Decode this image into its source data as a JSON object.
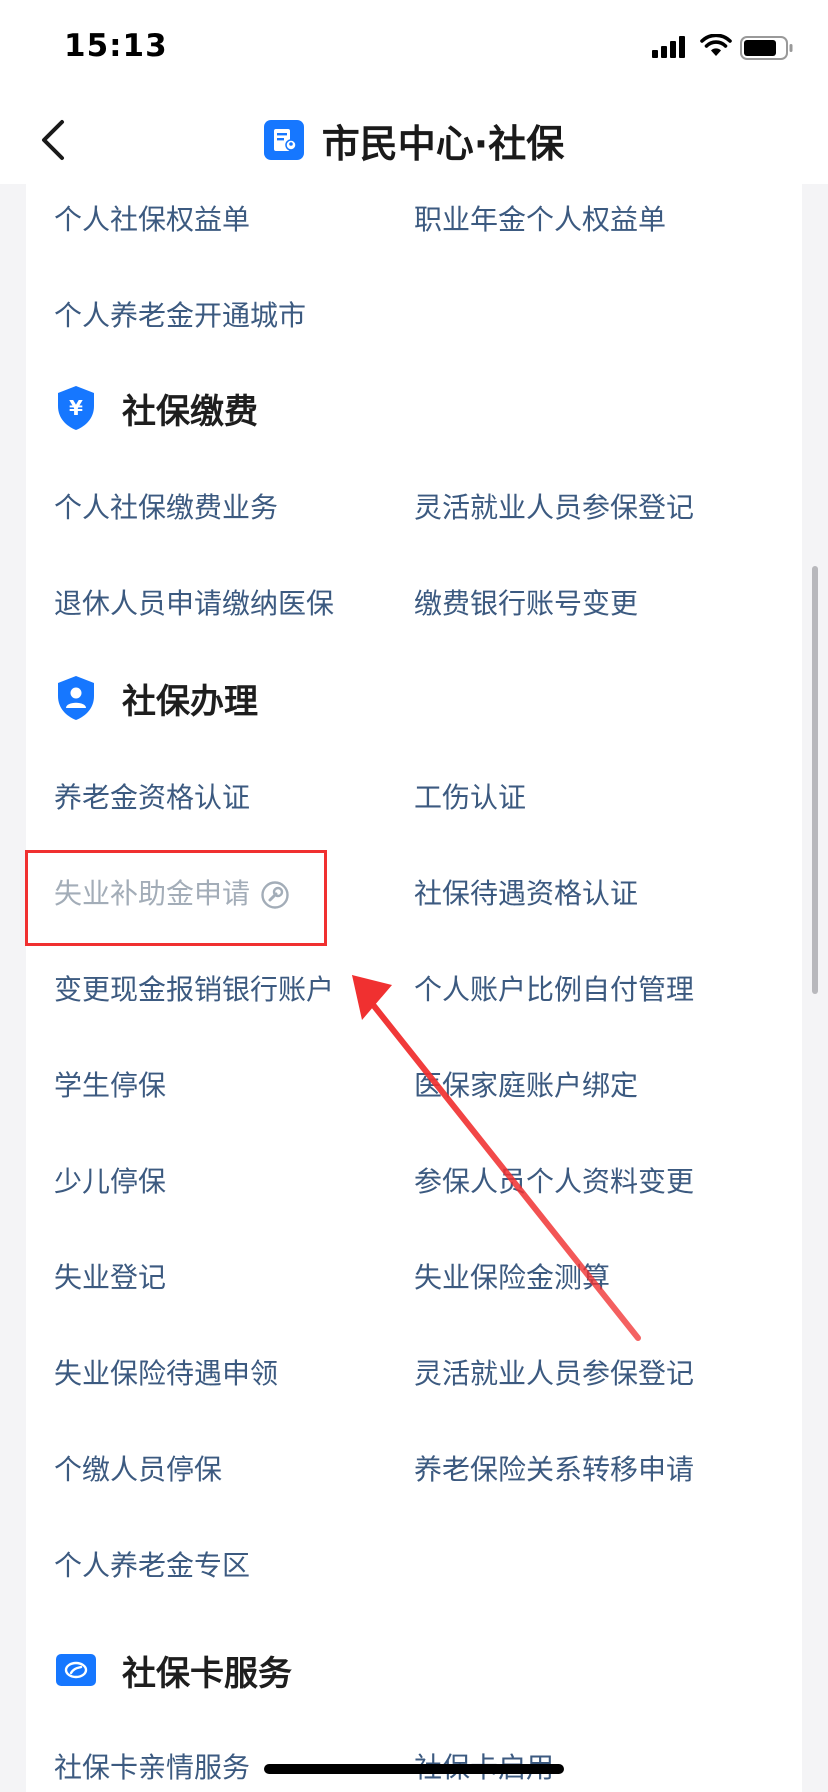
{
  "status_bar": {
    "time": "15:13"
  },
  "nav": {
    "title": "市民中心·社保"
  },
  "top_items": [
    {
      "label": "个人社保权益单"
    },
    {
      "label": "职业年金个人权益单"
    },
    {
      "label": "个人养老金开通城市"
    }
  ],
  "sections": [
    {
      "title": "社保缴费",
      "items": [
        {
          "label": "个人社保缴费业务"
        },
        {
          "label": "灵活就业人员参保登记"
        },
        {
          "label": "退休人员申请缴纳医保"
        },
        {
          "label": "缴费银行账号变更"
        }
      ]
    },
    {
      "title": "社保办理",
      "items": [
        {
          "label": "养老金资格认证"
        },
        {
          "label": "工伤认证"
        },
        {
          "label": "失业补助金申请",
          "state": "disabled"
        },
        {
          "label": "社保待遇资格认证"
        },
        {
          "label": "变更现金报销银行账户"
        },
        {
          "label": "个人账户比例自付管理"
        },
        {
          "label": "学生停保"
        },
        {
          "label": "医保家庭账户绑定"
        },
        {
          "label": "少儿停保"
        },
        {
          "label": "参保人员个人资料变更"
        },
        {
          "label": "失业登记"
        },
        {
          "label": "失业保险金测算"
        },
        {
          "label": "失业保险待遇申领"
        },
        {
          "label": "灵活就业人员参保登记"
        },
        {
          "label": "个缴人员停保"
        },
        {
          "label": "养老保险关系转移申请"
        },
        {
          "label": "个人养老金专区"
        }
      ]
    },
    {
      "title": "社保卡服务",
      "items": [
        {
          "label": "社保卡亲情服务"
        },
        {
          "label": "社保卡启用"
        }
      ]
    }
  ],
  "colors": {
    "accent": "#1677ff",
    "item_text": "#3c5a80",
    "disabled_text": "#a3adb8",
    "annotation_red": "#f03030"
  },
  "icons": {
    "back": "chevron-left-icon",
    "logo": "document-person-icon",
    "payment": "shield-yen-icon",
    "handling": "shield-person-icon",
    "card": "social-security-card-icon",
    "maintenance": "wrench-circle-icon"
  }
}
